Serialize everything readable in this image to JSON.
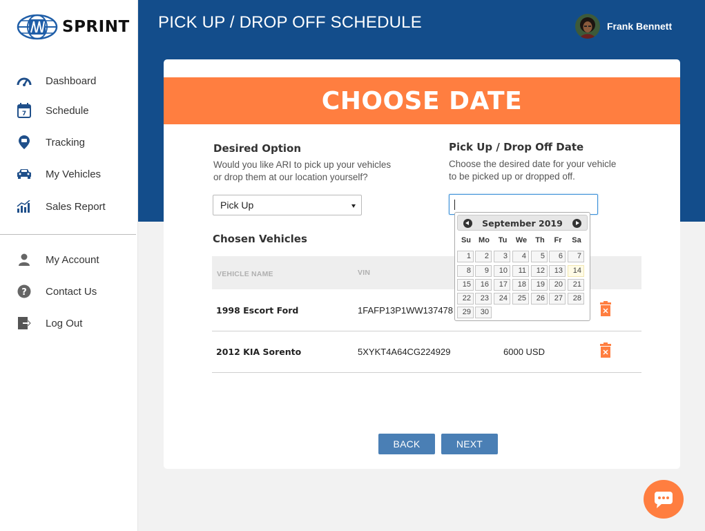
{
  "brand": {
    "name": "SPRINT",
    "accent": "#ff7e40",
    "header_bg": "#134d8b",
    "button": "#4a7fb5"
  },
  "sidebar": {
    "items": [
      {
        "label": "Dashboard",
        "icon": "dashboard-gauge-icon"
      },
      {
        "label": "Schedule",
        "icon": "calendar-icon"
      },
      {
        "label": "Tracking",
        "icon": "location-pin-icon"
      },
      {
        "label": "My Vehicles",
        "icon": "car-icon"
      },
      {
        "label": "Sales Report",
        "icon": "bar-chart-icon"
      }
    ],
    "account_items": [
      {
        "label": "My Account",
        "icon": "user-icon"
      },
      {
        "label": "Contact Us",
        "icon": "help-icon"
      },
      {
        "label": "Log Out",
        "icon": "logout-icon"
      }
    ]
  },
  "header": {
    "title": "PICK UP / DROP OFF SCHEDULE",
    "user_name": "Frank Bennett"
  },
  "card": {
    "banner": "CHOOSE DATE",
    "desired_option": {
      "title": "Desired Option",
      "description_line1": "Would you like ARI to pick up your vehicles",
      "description_line2": "or drop them at our location yourself?",
      "selected": "Pick Up"
    },
    "date": {
      "title": "Pick Up / Drop Off Date",
      "description_line1": "Choose the desired date for your vehicle",
      "description_line2": "to be picked up or dropped off.",
      "value": ""
    },
    "vehicles": {
      "title": "Chosen Vehicles",
      "columns": [
        "VEHICLE NAME",
        "VIN"
      ],
      "rows": [
        {
          "name": "1998 Escort Ford",
          "vin": "1FAFP13P1WW137478",
          "price": ""
        },
        {
          "name": "2012 KIA Sorento",
          "vin": "5XYKT4A64CG224929",
          "price": "6000 USD"
        }
      ]
    },
    "back_label": "BACK",
    "next_label": "NEXT"
  },
  "datepicker": {
    "month_label": "September 2019",
    "weekdays": [
      "Su",
      "Mo",
      "Tu",
      "We",
      "Th",
      "Fr",
      "Sa"
    ],
    "days_in_month": 30,
    "first_weekday_index": 0,
    "today": 14
  },
  "chat": {
    "icon": "chat-bubble-icon"
  }
}
